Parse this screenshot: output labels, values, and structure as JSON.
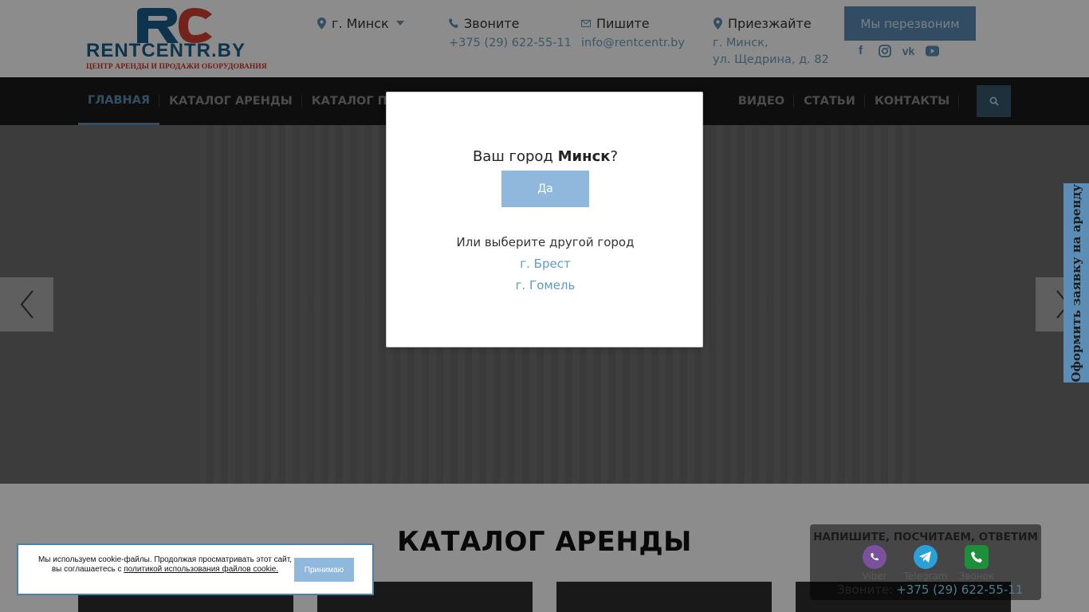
{
  "header": {
    "logo_text": "RENTCENTR.BY",
    "logo_tagline": "ЦЕНТР АРЕНДЫ И ПРОДАЖИ ОБОРУДОВАНИЯ",
    "city": "г. Минск",
    "call_title": "Звоните",
    "call_phone": "+375 (29) 622-55-11",
    "mail_title": "Пишите",
    "mail_address": "info@rentcentr.by",
    "visit_title": "Приезжайте",
    "visit_line1": "г. Минск,",
    "visit_line2": "ул. Щедрина, д. 82",
    "callback_label": "Мы перезвоним",
    "socials": [
      "facebook-icon",
      "instagram-icon",
      "vk-icon",
      "youtube-icon"
    ]
  },
  "nav": {
    "items": [
      {
        "label": "ГЛАВНАЯ",
        "active": true
      },
      {
        "label": "КАТАЛОГ АРЕНДЫ"
      },
      {
        "label": "КАТАЛОГ ПРОДАЖ"
      },
      {
        "label": "ВИДЕО"
      },
      {
        "label": "СТАТЬИ"
      },
      {
        "label": "КОНТАКТЫ"
      }
    ]
  },
  "modal": {
    "question_prefix": "Ваш город ",
    "question_city": "Минск",
    "question_suffix": "?",
    "yes_label": "Да",
    "other_text": "Или выберите другой город",
    "cities": [
      "г. Брест",
      "г. Гомель"
    ]
  },
  "side_tab": {
    "label": "Оформить заявку на аренду"
  },
  "catalog": {
    "title": "КАТАЛОГ АРЕНДЫ"
  },
  "cookie": {
    "text_line1": "Мы используем cookie-файлы. Продолжая просматривать этот сайт,",
    "text_line2_prefix": "вы соглашаетесь с ",
    "link_text": "политикой использования файлов cookie.",
    "accept_label": "Принимаю"
  },
  "messenger": {
    "title": "НАПИШИТЕ, ПОСЧИТАЕМ, ОТВЕТИМ",
    "items": [
      {
        "label": "Viber",
        "color": "#7b519d"
      },
      {
        "label": "Telegram",
        "color": "#2aa0d8"
      },
      {
        "label": "Звонок",
        "color": "#1d8f3a"
      }
    ],
    "call_label": "Звоните:",
    "call_phone": "+375 (29) 622-55-11"
  },
  "colors": {
    "accent": "#5c8db5",
    "link": "#5b9bc7",
    "nav_bg": "#1b1b1b"
  }
}
